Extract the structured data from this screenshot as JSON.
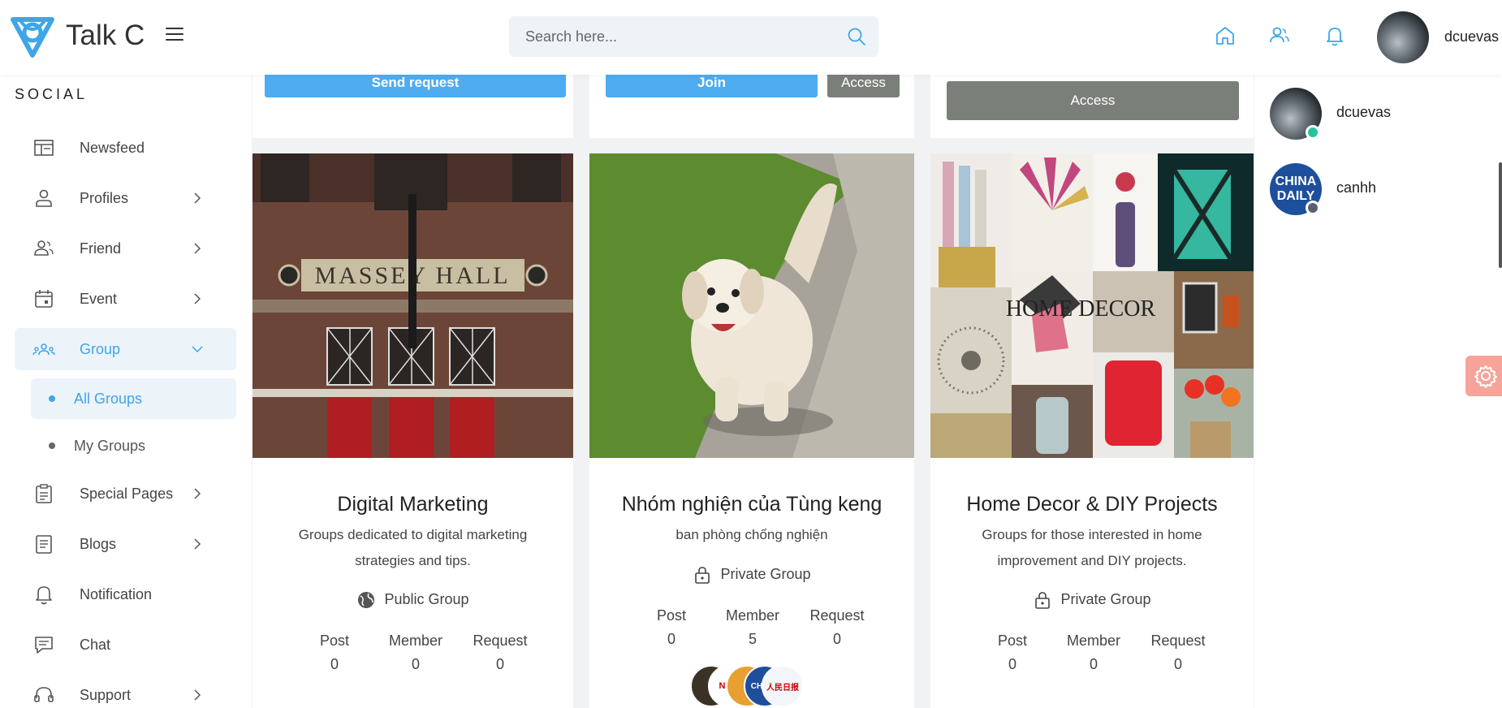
{
  "header": {
    "brand": "Talk C",
    "search_placeholder": "Search here...",
    "username": "dcuevas"
  },
  "sidebar": {
    "section_title": "SOCIAL",
    "items": [
      {
        "label": "Newsfeed",
        "icon": "newsfeed-icon"
      },
      {
        "label": "Profiles",
        "icon": "user-icon"
      },
      {
        "label": "Friend",
        "icon": "friends-icon"
      },
      {
        "label": "Event",
        "icon": "calendar-icon"
      },
      {
        "label": "Group",
        "icon": "group-icon"
      },
      {
        "label": "Special Pages",
        "icon": "clipboard-icon"
      },
      {
        "label": "Blogs",
        "icon": "document-icon"
      },
      {
        "label": "Notification",
        "icon": "bell-icon"
      },
      {
        "label": "Chat",
        "icon": "chat-icon"
      },
      {
        "label": "Support",
        "icon": "headset-icon"
      }
    ],
    "group_sub": [
      "All Groups",
      "My Groups"
    ]
  },
  "top_buttons": {
    "send_request": "Send request",
    "join": "Join",
    "access": "Access",
    "access_wide": "Access"
  },
  "groups": [
    {
      "title": "Digital Marketing",
      "desc_line1": "Groups dedicated to digital marketing",
      "desc_line2": "strategies and tips.",
      "privacy": "Public Group",
      "post": "0",
      "member": "0",
      "request": "0"
    },
    {
      "title": "Nhóm nghiện của Tùng keng",
      "desc_line1": "ban phòng chống nghiện",
      "privacy": "Private Group",
      "post": "0",
      "member": "5",
      "request": "0"
    },
    {
      "title": "Home Decor & DIY Projects",
      "desc_line1": "Groups for those interested in home",
      "desc_line2": "improvement and DIY projects.",
      "privacy": "Private Group",
      "post": "0",
      "member": "0",
      "request": "0"
    }
  ],
  "stat_labels": {
    "post": "Post",
    "member": "Member",
    "request": "Request"
  },
  "image_text": {
    "massey": "MASSEY HALL",
    "home_decor": "HOME DECOR"
  },
  "member_avatars": [
    "NETI",
    "CHI DA",
    "人民日报"
  ],
  "contacts": [
    {
      "name": "dcuevas",
      "status": "online"
    },
    {
      "name": "canhh",
      "status": "offline",
      "avatar_text": "CHINA DAILY"
    }
  ],
  "colors": {
    "accent": "#3ea6e8",
    "button_blue": "#4eacf0",
    "button_gray": "#7b7f79",
    "online": "#27c3a0",
    "offline": "#5a6070",
    "settings": "#f6a49a"
  }
}
